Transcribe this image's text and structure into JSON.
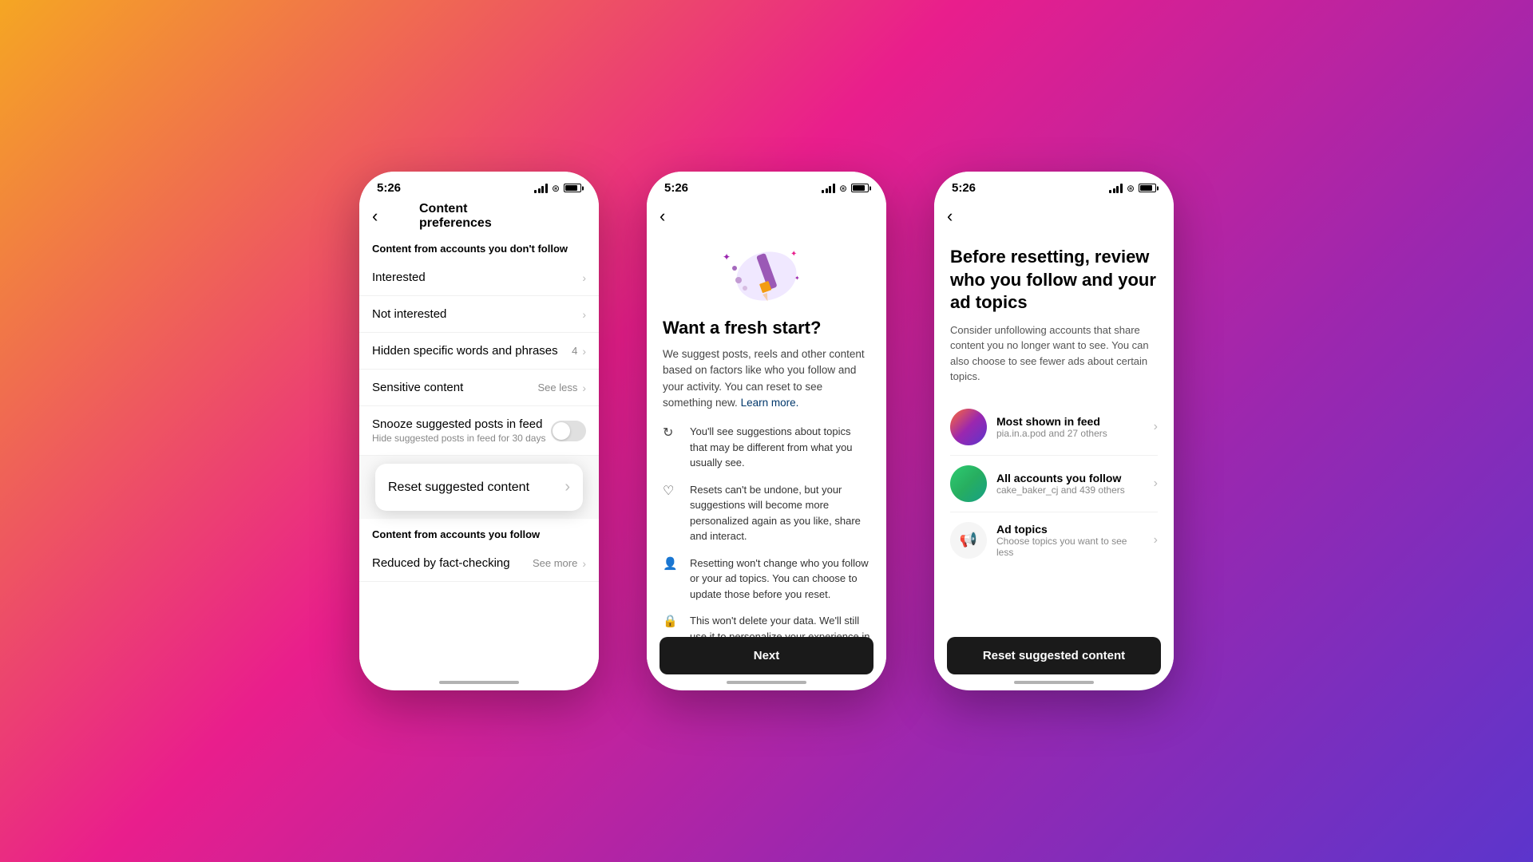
{
  "background": {
    "gradient": "linear-gradient(135deg, #f5a623 0%, #e91e8c 40%, #9b27af 70%, #5c35cc 100%)"
  },
  "phone1": {
    "status": {
      "time": "5:26"
    },
    "header": {
      "title": "Content preferences",
      "back_label": "‹"
    },
    "section1": {
      "label": "Content from accounts you don't follow",
      "items": [
        {
          "title": "Interested",
          "badge": "",
          "has_chevron": true
        },
        {
          "title": "Not interested",
          "badge": "",
          "has_chevron": true
        },
        {
          "title": "Hidden specific words and phrases",
          "badge": "4",
          "has_chevron": true
        },
        {
          "title": "Sensitive content",
          "badge": "See less",
          "has_chevron": true
        }
      ]
    },
    "snooze": {
      "title": "Snooze suggested posts in feed",
      "subtitle": "Hide suggested posts in feed for 30 days"
    },
    "popup": {
      "title": "Reset suggested content",
      "chevron": "›"
    },
    "section2": {
      "label": "Content from accounts you follow",
      "items": [
        {
          "title": "Reduced by fact-checking",
          "badge": "See more",
          "has_chevron": true
        }
      ]
    }
  },
  "phone2": {
    "status": {
      "time": "5:26"
    },
    "title": "Want a fresh start?",
    "description": "We suggest posts, reels and other content based on factors like who you follow and your activity. You can reset to see something new.",
    "learn_more": "Learn more.",
    "bullets": [
      {
        "icon": "↻",
        "text": "You'll see suggestions about topics that may be different from what you usually see."
      },
      {
        "icon": "♡",
        "text": "Resets can't be undone, but your suggestions will become more personalized again as you like, share and interact."
      },
      {
        "icon": "👤",
        "text": "Resetting won't change who you follow or your ad topics. You can choose to update those before you reset."
      },
      {
        "icon": "🔒",
        "text": "This won't delete your data. We'll still use it to personalize your experience in other ways and for the purposes explained in our Privacy Policy."
      }
    ],
    "next_button": "Next"
  },
  "phone3": {
    "status": {
      "time": "5:26"
    },
    "title": "Before resetting, review who you follow and your ad topics",
    "description": "Consider unfollowing accounts that share content you no longer want to see. You can also choose to see fewer ads about certain topics.",
    "items": [
      {
        "title": "Most shown in feed",
        "subtitle": "pia.in.a.pod and 27 others",
        "type": "avatar1"
      },
      {
        "title": "All accounts you follow",
        "subtitle": "cake_baker_cj and 439 others",
        "type": "avatar2"
      },
      {
        "title": "Ad topics",
        "subtitle": "Choose topics you want to see less",
        "type": "ad"
      }
    ],
    "reset_button": "Reset suggested content"
  }
}
